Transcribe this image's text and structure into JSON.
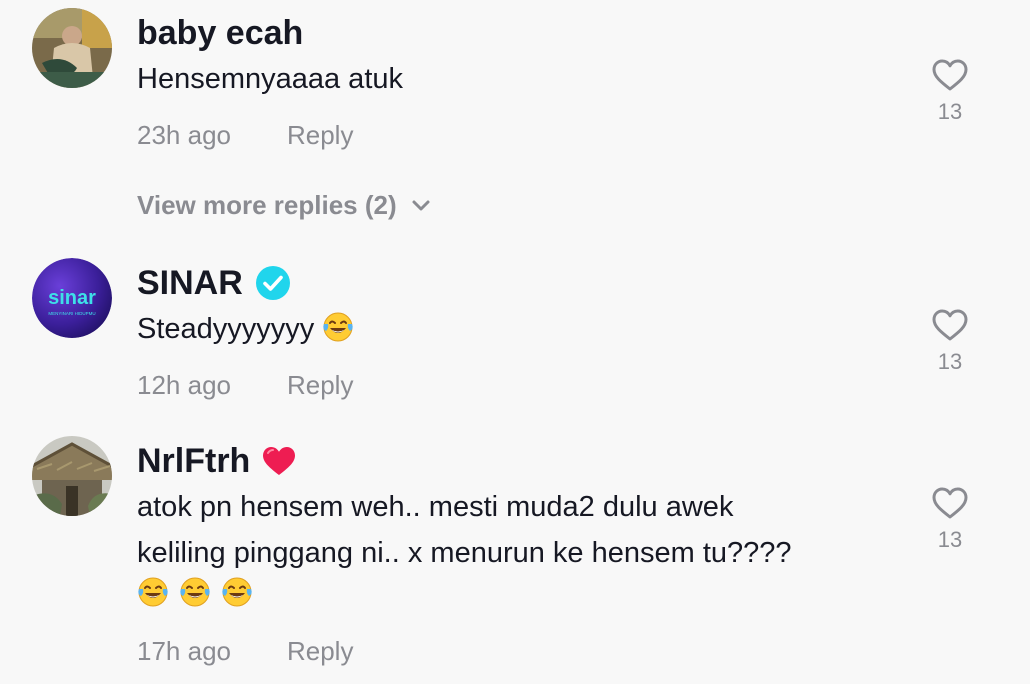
{
  "comments": [
    {
      "username": "baby ecah",
      "text": "Hensemnyaaaa atuk",
      "time": "23h ago",
      "reply_label": "Reply",
      "likes": "13",
      "avatar_icon": "user-photo-avatar"
    },
    {
      "username": "SINAR",
      "text": "Steadyyyyyyy",
      "time": "12h ago",
      "reply_label": "Reply",
      "likes": "13",
      "verified": true,
      "avatar_logo_text": "sinar",
      "avatar_tagline": "MENYINARI HIDUPMU",
      "avatar_icon": "sinar-logo-avatar",
      "text_emoji": "face-with-tears-of-joy"
    },
    {
      "username": "NrlFtrh",
      "text_line1": "atok pn hensem weh.. mesti muda2 dulu awek",
      "text_line2": "keliling pinggang ni.. x menurun ke hensem tu????",
      "time": "17h ago",
      "reply_label": "Reply",
      "likes": "13",
      "name_emoji": "red-heart",
      "avatar_icon": "hut-photo-avatar",
      "text_emoji": "face-with-tears-of-joy"
    }
  ],
  "view_more_replies": "View more replies (2)",
  "colors": {
    "background": "#f8f8f8",
    "primary_text": "#161823",
    "secondary_text": "#8a8b91",
    "verified_badge": "#20d5ec",
    "heart_emoji": "#ee1d52"
  }
}
